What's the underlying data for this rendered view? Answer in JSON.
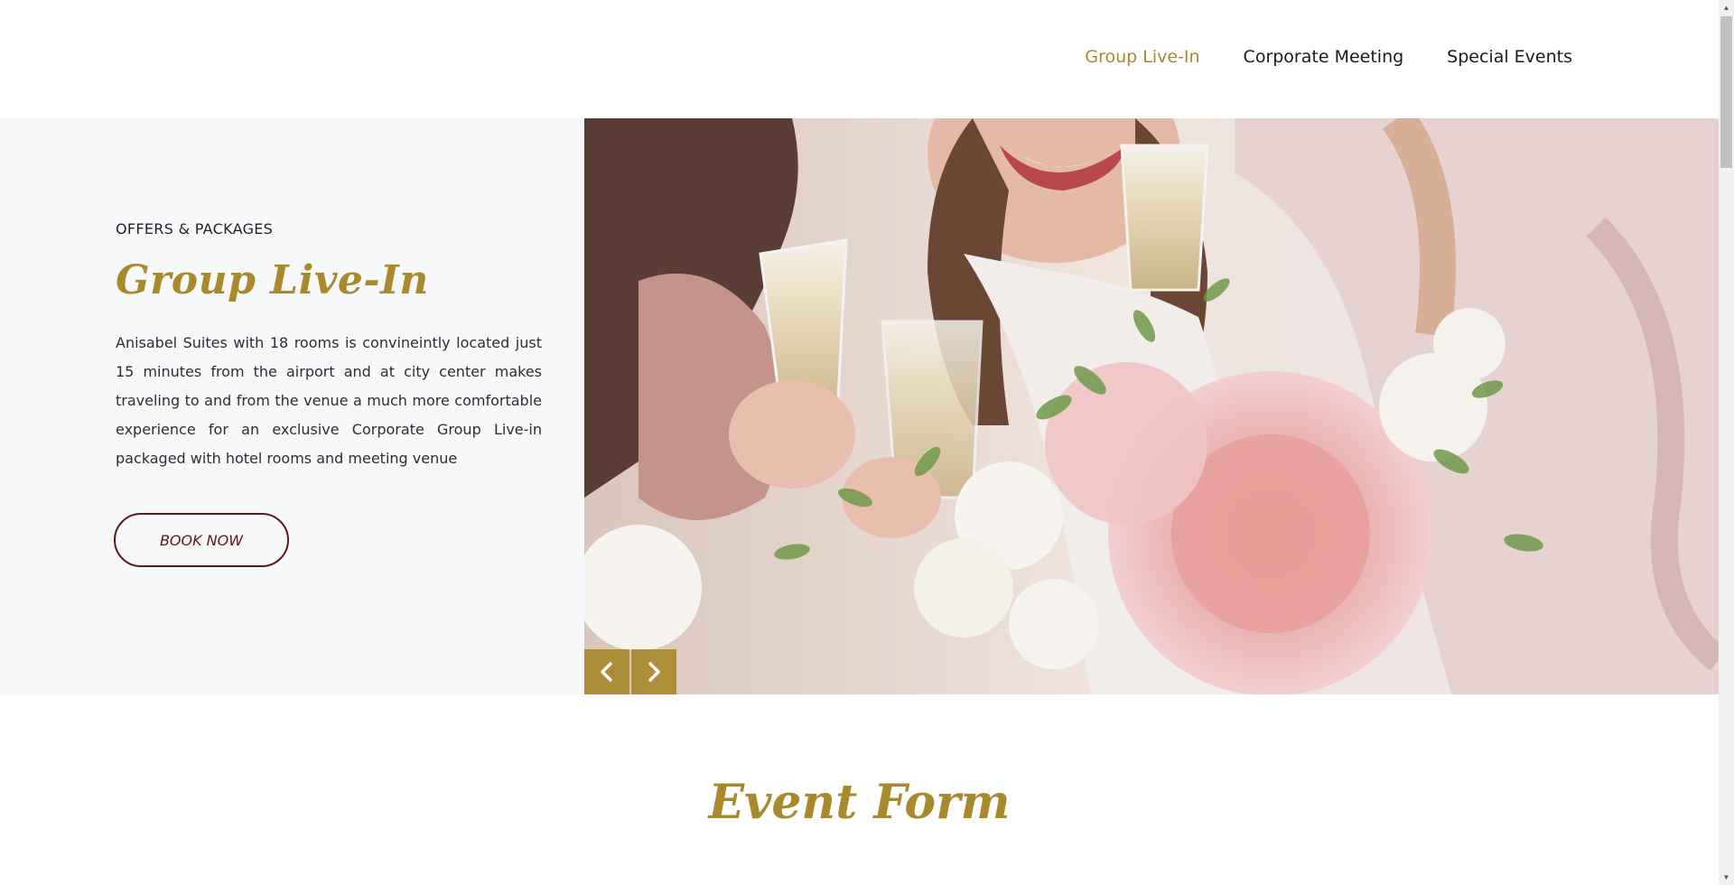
{
  "nav": {
    "items": [
      {
        "label": "Group Live-In",
        "active": true
      },
      {
        "label": "Corporate Meeting",
        "active": false
      },
      {
        "label": "Special Events",
        "active": false
      }
    ]
  },
  "hero": {
    "eyebrow": "OFFERS & PACKAGES",
    "title": "Group Live-In",
    "description": "Anisabel Suites with 18 rooms is convineintly located just 15 minutes from the airport and at city center makes traveling to and from the venue a much more comfortable experience for an exclusive Corporate Group Live-in packaged with hotel rooms and meeting venue",
    "book_label": "BOOK NOW"
  },
  "slider": {
    "prev_icon": "chevron-left-icon",
    "next_icon": "chevron-right-icon"
  },
  "event_form": {
    "title": "Event Form"
  },
  "colors": {
    "accent": "#a88a2c",
    "button_border": "#5e1818",
    "hero_bg": "#f7f8f9"
  }
}
